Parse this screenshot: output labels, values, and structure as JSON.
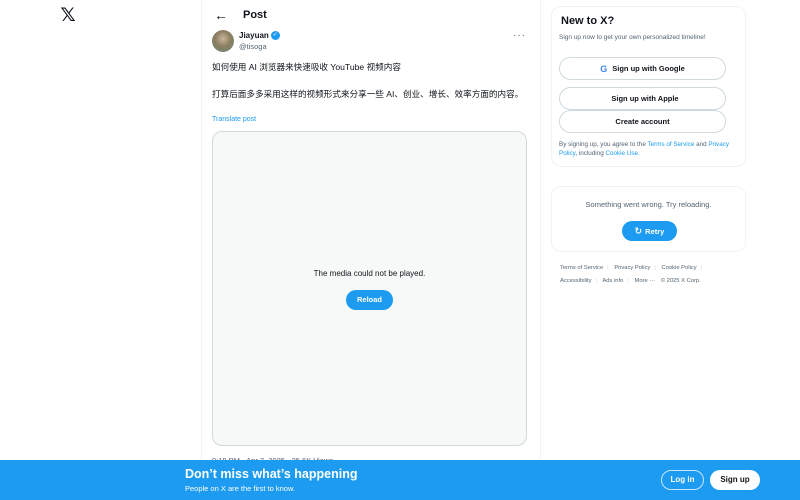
{
  "nav": {
    "logo": "𝕏"
  },
  "header": {
    "back_icon": "←",
    "title": "Post"
  },
  "post": {
    "author_name": "Jiayuan",
    "verified_icon": "✓",
    "handle": "@tisoga",
    "more_icon": "···",
    "text_line1": "如何使用 AI 浏览器来快速吸收 YouTube 视频内容",
    "text_line2": "打算后面多多采用这样的视频形式来分享一些 AI、创业、增长、效率方面的内容。",
    "translate": "Translate post",
    "media_message": "The media could not be played.",
    "reload_label": "Reload",
    "timestamp_partial": "9:18 PM · Apr 7, 2025 · 25.6K Views"
  },
  "signup_card": {
    "title": "New to X?",
    "subtitle": "Sign up now to get your own personalized timeline!",
    "google_label": "Sign up with Google",
    "google_icon": "G",
    "apple_label": "Sign up with Apple",
    "apple_icon": "",
    "create_label": "Create account",
    "terms_prefix": "By signing up, you agree to the ",
    "terms_link": "Terms of Service",
    "terms_and": " and ",
    "privacy_link": "Privacy Policy",
    "cookie_prefix": ", including ",
    "cookie_link": "Cookie Use."
  },
  "error_card": {
    "message": "Something went wrong. Try reloading.",
    "retry_icon": "↻",
    "retry_label": "Retry"
  },
  "footer": {
    "terms": "Terms of Service",
    "privacy": "Privacy Policy",
    "cookie": "Cookie Policy",
    "accessibility": "Accessibility",
    "ads": "Ads info",
    "more": "More ···",
    "copyright": "© 2025 X Corp."
  },
  "bottom_bar": {
    "title": "Don’t miss what’s happening",
    "subtitle": "People on X are the first to know.",
    "login_label": "Log in",
    "signup_label": "Sign up"
  }
}
